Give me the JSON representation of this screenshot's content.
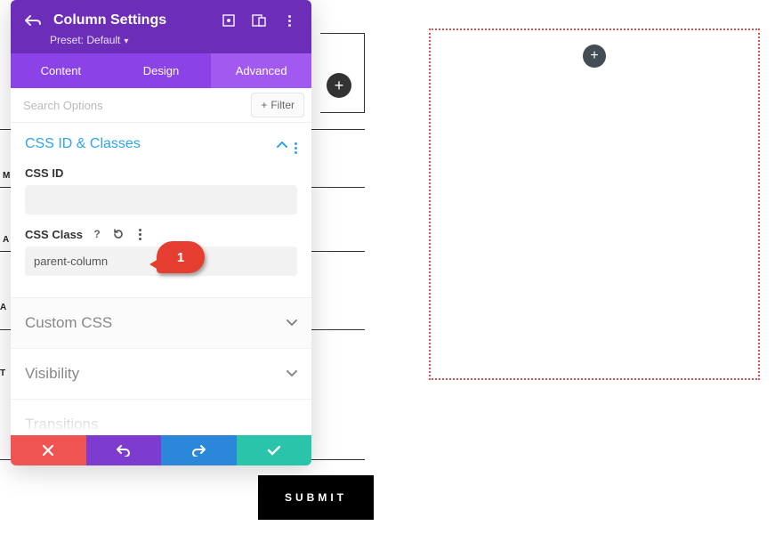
{
  "panel": {
    "title": "Column Settings",
    "preset": "Preset: Default",
    "tabs": {
      "content": "Content",
      "design": "Design",
      "advanced": "Advanced"
    },
    "search_placeholder": "Search Options",
    "filter_label": "Filter",
    "sections": {
      "css_id_classes": {
        "title": "CSS ID & Classes",
        "css_id_label": "CSS ID",
        "css_id_value": "",
        "css_class_label": "CSS Class",
        "css_class_value": "parent-column"
      },
      "custom_css": {
        "title": "Custom CSS"
      },
      "visibility": {
        "title": "Visibility"
      },
      "transitions": {
        "title": "Transitions"
      }
    },
    "callout": "1"
  },
  "bg_labels": {
    "m": "M",
    "a": "A",
    "an": "A N",
    "t": "T E"
  },
  "submit": "SUBMIT",
  "icons": {
    "back": "back-icon",
    "expand": "expand-icon",
    "responsive": "responsive-icon",
    "kebab": "kebab-icon",
    "plus": "plus-icon",
    "chevron_up": "chevron-up-icon",
    "chevron_down": "chevron-down-icon",
    "help": "help-icon",
    "reset": "reset-icon",
    "close": "close-icon",
    "undo": "undo-icon",
    "redo": "redo-icon",
    "check": "check-icon"
  }
}
